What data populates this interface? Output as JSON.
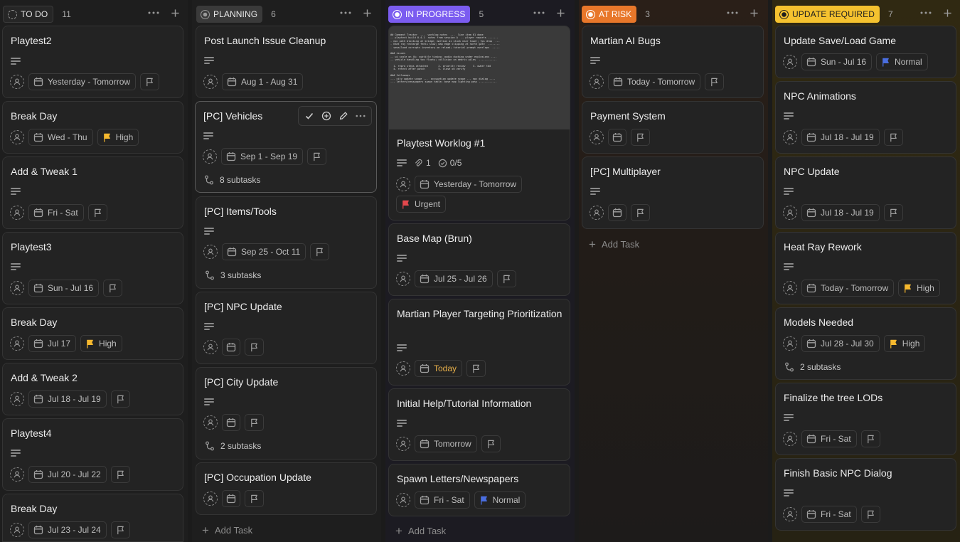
{
  "colors": {
    "todo": "#8e8e8e",
    "planning": "#3a3a3a",
    "in_progress": "#7b5cf0",
    "at_risk": "#e8772a",
    "update_required": "#f5c22f",
    "flag_high": "#f5b82e",
    "flag_urgent": "#e5484d",
    "flag_normal": "#4a6ee0",
    "today": "#e8b04a"
  },
  "add_task_label": "Add Task",
  "columns": [
    {
      "label": "TO DO",
      "count": "11",
      "cards": [
        {
          "title": "Playtest2",
          "date": "Yesterday - Tomorrow"
        },
        {
          "title": "Break Day",
          "date": "Wed - Thu",
          "priority": "High"
        },
        {
          "title": "Add & Tweak 1",
          "date": "Fri - Sat"
        },
        {
          "title": "Playtest3",
          "date": "Sun - Jul 16"
        },
        {
          "title": "Break Day",
          "date": "Jul 17",
          "priority": "High"
        },
        {
          "title": "Add & Tweak 2",
          "date": "Jul 18 - Jul 19"
        },
        {
          "title": "Playtest4",
          "date": "Jul 20 - Jul 22"
        },
        {
          "title": "Break Day",
          "date": "Jul 23 - Jul 24"
        }
      ]
    },
    {
      "label": "PLANNING",
      "count": "6",
      "cards": [
        {
          "title": "Post Launch Issue Cleanup",
          "date": "Aug 1 - Aug 31"
        },
        {
          "title": "[PC] Vehicles",
          "date": "Sep 1 - Sep 19",
          "subtasks": "8 subtasks"
        },
        {
          "title": "[PC] Items/Tools",
          "date": "Sep 25 - Oct 11",
          "subtasks": "3 subtasks"
        },
        {
          "title": "[PC] NPC Update"
        },
        {
          "title": "[PC] City Update",
          "subtasks": "2 subtasks"
        },
        {
          "title": "[PC] Occupation Update"
        }
      ]
    },
    {
      "label": "IN PROGRESS",
      "count": "5",
      "cards": [
        {
          "title": "Playtest Worklog #1",
          "attachments": "1",
          "checklist": "0/5",
          "date": "Yesterday - Tomorrow",
          "priority": "Urgent"
        },
        {
          "title": "Base Map (Brun)",
          "date": "Jul 25 - Jul 26"
        },
        {
          "title": "Martian Player Targeting Prioritization",
          "date": "Today"
        },
        {
          "title": "Initial Help/Tutorial Information",
          "date": "Tomorrow"
        },
        {
          "title": "Spawn Letters/Newspapers",
          "date": "Fri - Sat",
          "priority": "Normal"
        }
      ]
    },
    {
      "label": "AT RISK",
      "count": "3",
      "cards": [
        {
          "title": "Martian AI Bugs",
          "date": "Today - Tomorrow"
        },
        {
          "title": "Payment System"
        },
        {
          "title": "[PC] Multiplayer"
        }
      ]
    },
    {
      "label": "UPDATE REQUIRED",
      "count": "7",
      "cards": [
        {
          "title": "Update Save/Load Game",
          "date": "Sun - Jul 16",
          "priority": "Normal"
        },
        {
          "title": "NPC Animations",
          "date": "Jul 18 - Jul 19"
        },
        {
          "title": "NPC Update",
          "date": "Jul 18 - Jul 19"
        },
        {
          "title": "Heat Ray Rework",
          "date": "Today - Tomorrow",
          "priority": "High"
        },
        {
          "title": "Models Needed",
          "date": "Jul 28 - Jul 30",
          "priority": "High",
          "subtasks": "2 subtasks"
        },
        {
          "title": "Finalize the tree LODs",
          "date": "Fri - Sat"
        },
        {
          "title": "Finish Basic NPC Dialog",
          "date": "Fri - Sat"
        }
      ]
    }
  ]
}
